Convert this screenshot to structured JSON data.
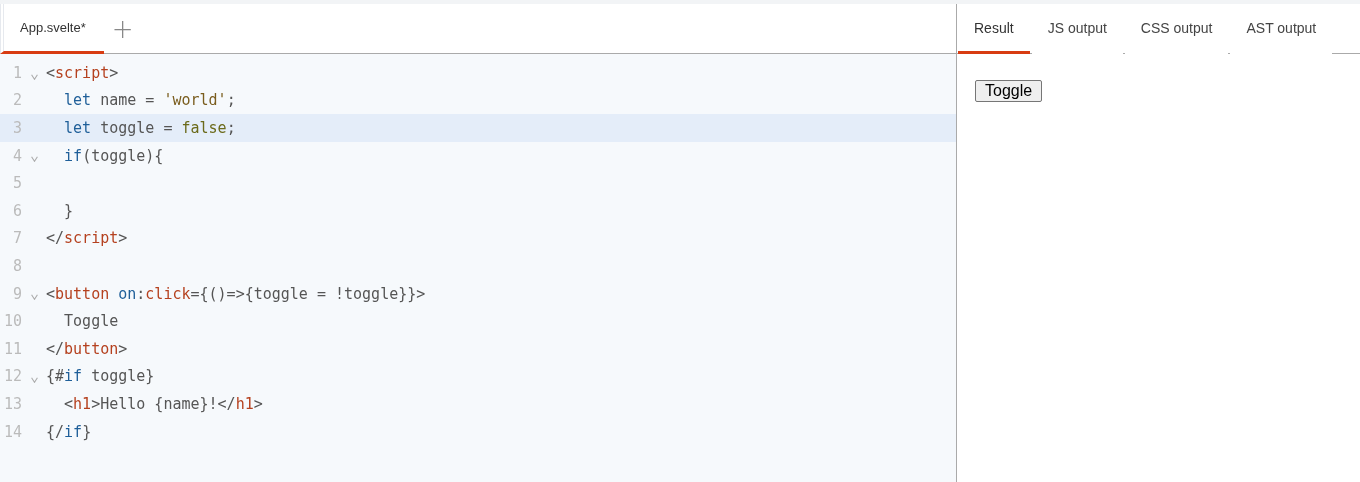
{
  "editor_tabs": [
    {
      "label": "App.svelte*",
      "selected": true
    }
  ],
  "add_tab": {
    "label": "+"
  },
  "code_lines": [
    {
      "number": "1",
      "foldable": true,
      "highlighted": false,
      "tokens": [
        {
          "kind": "punct",
          "text": "<"
        },
        {
          "kind": "tag",
          "text": "script"
        },
        {
          "kind": "punct",
          "text": ">"
        }
      ]
    },
    {
      "number": "2",
      "foldable": false,
      "highlighted": false,
      "tokens": [
        {
          "kind": "keyword",
          "text": "  let"
        },
        {
          "kind": "plain",
          "text": " name = "
        },
        {
          "kind": "string",
          "text": "'world'"
        },
        {
          "kind": "plain",
          "text": ";"
        }
      ]
    },
    {
      "number": "3",
      "foldable": false,
      "highlighted": true,
      "tokens": [
        {
          "kind": "keyword",
          "text": "  let"
        },
        {
          "kind": "plain",
          "text": " toggle = "
        },
        {
          "kind": "atom",
          "text": "false"
        },
        {
          "kind": "plain",
          "text": ";"
        }
      ]
    },
    {
      "number": "4",
      "foldable": true,
      "highlighted": false,
      "tokens": [
        {
          "kind": "keyword",
          "text": "  if"
        },
        {
          "kind": "plain",
          "text": "(toggle){"
        }
      ]
    },
    {
      "number": "5",
      "foldable": false,
      "highlighted": false
    },
    {
      "number": "6",
      "foldable": false,
      "highlighted": false,
      "tokens": [
        {
          "kind": "plain",
          "text": "  }"
        }
      ]
    },
    {
      "number": "7",
      "foldable": false,
      "highlighted": false,
      "tokens": [
        {
          "kind": "punct",
          "text": "</"
        },
        {
          "kind": "tag",
          "text": "script"
        },
        {
          "kind": "punct",
          "text": ">"
        }
      ]
    },
    {
      "number": "8",
      "foldable": false,
      "highlighted": false
    },
    {
      "number": "9",
      "foldable": true,
      "highlighted": false,
      "tokens": [
        {
          "kind": "punct",
          "text": "<"
        },
        {
          "kind": "tag",
          "text": "button"
        },
        {
          "kind": "keyword",
          "text": " on"
        },
        {
          "kind": "plain",
          "text": ":"
        },
        {
          "kind": "tag",
          "text": "click"
        },
        {
          "kind": "plain",
          "text": "={()=>{toggle = !toggle}}"
        },
        {
          "kind": "punct",
          "text": ">"
        }
      ]
    },
    {
      "number": "10",
      "foldable": false,
      "highlighted": false,
      "tokens": [
        {
          "kind": "plain",
          "text": "  Toggle"
        }
      ]
    },
    {
      "number": "11",
      "foldable": false,
      "highlighted": false,
      "tokens": [
        {
          "kind": "punct",
          "text": "</"
        },
        {
          "kind": "tag",
          "text": "button"
        },
        {
          "kind": "punct",
          "text": ">"
        }
      ]
    },
    {
      "number": "12",
      "foldable": true,
      "highlighted": false,
      "tokens": [
        {
          "kind": "plain",
          "text": "{#"
        },
        {
          "kind": "keyword",
          "text": "if"
        },
        {
          "kind": "plain",
          "text": " toggle}"
        }
      ]
    },
    {
      "number": "13",
      "foldable": false,
      "highlighted": false,
      "tokens": [
        {
          "kind": "punct",
          "text": "  <"
        },
        {
          "kind": "tag",
          "text": "h1"
        },
        {
          "kind": "punct",
          "text": ">"
        },
        {
          "kind": "plain",
          "text": "Hello {name}!"
        },
        {
          "kind": "punct",
          "text": "</"
        },
        {
          "kind": "tag",
          "text": "h1"
        },
        {
          "kind": "punct",
          "text": ">"
        }
      ]
    },
    {
      "number": "14",
      "foldable": false,
      "highlighted": false,
      "tokens": [
        {
          "kind": "plain",
          "text": "{/"
        },
        {
          "kind": "keyword",
          "text": "if"
        },
        {
          "kind": "plain",
          "text": "}"
        }
      ]
    }
  ],
  "output_tabs": [
    {
      "label": "Result",
      "selected": true
    },
    {
      "label": "JS output",
      "selected": false
    },
    {
      "label": "CSS output",
      "selected": false
    },
    {
      "label": "AST output",
      "selected": false
    }
  ],
  "result": {
    "button_label": "Toggle"
  }
}
